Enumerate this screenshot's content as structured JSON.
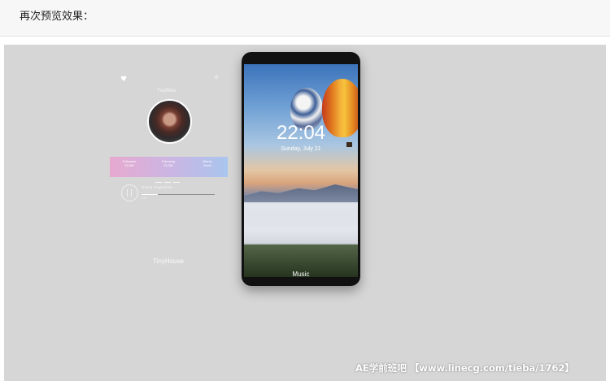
{
  "page": {
    "heading": "再次预览效果："
  },
  "profile_card": {
    "name": "FeatMax",
    "stats": [
      {
        "label": "Followers",
        "value": "23,554"
      },
      {
        "label": "Following",
        "value": "23,351"
      },
      {
        "label": "Words",
        "value": "2m/nl"
      }
    ],
    "track_title": "Round Original Mix",
    "track_time": "1:05",
    "track_progress": 0.22,
    "bottom_label": "TinyHouse"
  },
  "phone": {
    "clock": "22:04",
    "date": "Sunday, July 21",
    "bottom_label": "Music"
  },
  "watermark": "AE学前班吧 【www.linecg.com/tieba/1762】",
  "colors": {
    "canvas_bg": "#d6d6d6",
    "gradient_start": "#e7a9cf",
    "gradient_end": "#a9c6ee"
  }
}
